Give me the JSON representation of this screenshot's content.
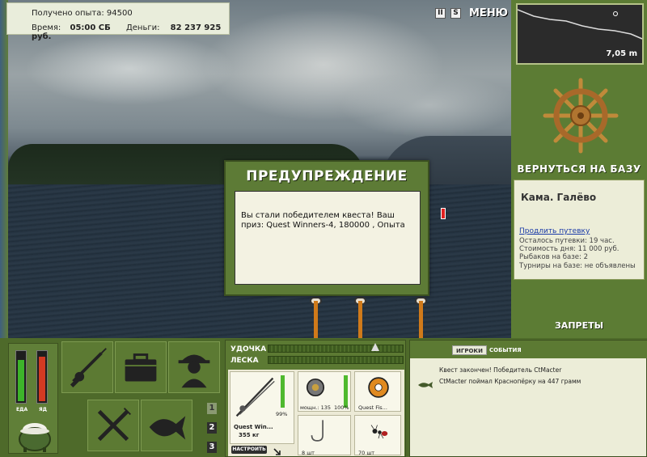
{
  "info": {
    "exp_text": "Получено опыта: 94500",
    "time_label": "Время:",
    "time_value": "05:00 СБ",
    "money_label": "Деньги:",
    "money_value": "82 237 925 руб."
  },
  "topbar": {
    "pause_label": "II",
    "sound_label": "S",
    "menu_label": "МЕНЮ"
  },
  "depth": {
    "value": "7,05 m"
  },
  "right": {
    "home_label": "ВЕРНУТЬСЯ НА БАЗУ",
    "base_name": "Кама. Галёво",
    "extend_link": "Продлить путевку",
    "remaining": "Осталось путевки: 19 час.",
    "day_cost": "Стоимость дня: 11 000 руб.",
    "fishers": "Рыбаков на базе: 2",
    "tournaments": "Турниры на базе: не объявлены",
    "bans_label": "ЗАПРЕТЫ"
  },
  "dialog": {
    "title": "ПРЕДУПРЕЖДЕНИЕ",
    "message": "Вы стали победителем квеста! Ваш приз: Quest Winners-4, 180000 , Опыта"
  },
  "status": {
    "food_label": "ЕДА",
    "poison_label": "ЯД",
    "food_level": 0.85,
    "poison_level": 0.92
  },
  "pages": [
    "1",
    "2",
    "3"
  ],
  "tackle": {
    "rod_label": "УДОЧКА",
    "line_label": "ЛЕСКА",
    "rod_name": "Quest Win...",
    "rod_weight": "355 кг",
    "rod_condition": "99%",
    "reel_power": "мощн.: 135",
    "reel_condition": "100%",
    "line_name": "Quest Fis...",
    "hooks_count": "8 шт",
    "bait_count": "70 шт",
    "adjust_label": "НАСТРОИТЬ",
    "rod_level": 0.99,
    "reel_level": 1.0
  },
  "events": {
    "tab_players": "ИГРОКИ",
    "tab_events": "СОБЫТИЯ",
    "line1": "Квест закончен! Победитель CtMacter",
    "line2": "CtMacter поймал Краснопёрку на 447 грамм"
  },
  "colors": {
    "panel_green": "#5c7a33",
    "accent_green": "#4fb92e",
    "food_bar": "#3db42a",
    "poison_bar": "#d23a22"
  }
}
